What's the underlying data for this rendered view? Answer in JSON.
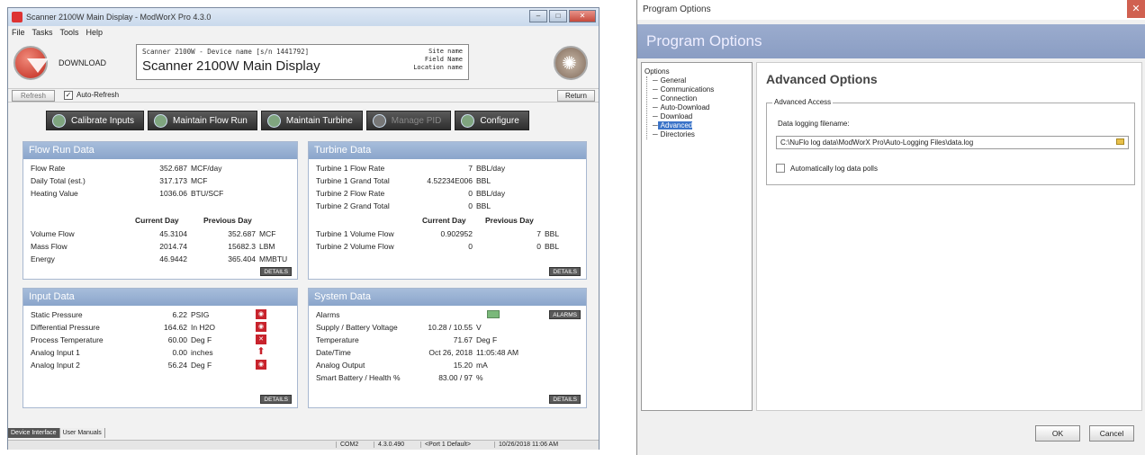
{
  "main_window": {
    "title": "Scanner 2100W Main Display - ModWorX Pro 4.3.0",
    "menu": [
      "File",
      "Tasks",
      "Tools",
      "Help"
    ],
    "download_label": "DOWNLOAD",
    "device_line": "Scanner 2100W - Device name [s/n 1441792]",
    "device_title": "Scanner 2100W Main Display",
    "site_name": "Site name",
    "field_name": "Field Name",
    "location_name": "Location name",
    "refresh_label": "Refresh",
    "auto_refresh_label": "Auto-Refresh",
    "return_label": "Return",
    "nav": {
      "calibrate": "Calibrate Inputs",
      "maintain_flow": "Maintain Flow Run",
      "maintain_turbine": "Maintain Turbine",
      "manage_pid": "Manage PID",
      "configure": "Configure"
    },
    "flow_run": {
      "title": "Flow Run Data",
      "rows": [
        {
          "label": "Flow Rate",
          "value": "352.687",
          "unit": "MCF/day"
        },
        {
          "label": "Daily Total (est.)",
          "value": "317.173",
          "unit": "MCF"
        },
        {
          "label": "Heating Value",
          "value": "1036.06",
          "unit": "BTU/SCF"
        }
      ],
      "current_day": "Current Day",
      "previous_day": "Previous Day",
      "history": [
        {
          "label": "Volume Flow",
          "current": "45.3104",
          "previous": "352.687",
          "unit": "MCF"
        },
        {
          "label": "Mass Flow",
          "current": "2014.74",
          "previous": "15682.3",
          "unit": "LBM"
        },
        {
          "label": "Energy",
          "current": "46.9442",
          "previous": "365.404",
          "unit": "MMBTU"
        }
      ],
      "details": "DETAILS"
    },
    "turbine": {
      "title": "Turbine Data",
      "rows": [
        {
          "label": "Turbine 1 Flow Rate",
          "value": "7",
          "unit": "BBL/day"
        },
        {
          "label": "Turbine 1 Grand Total",
          "value": "4.52234E006",
          "unit": "BBL"
        },
        {
          "label": "Turbine 2 Flow Rate",
          "value": "0",
          "unit": "BBL/day"
        },
        {
          "label": "Turbine 2 Grand Total",
          "value": "0",
          "unit": "BBL"
        }
      ],
      "current_day": "Current Day",
      "previous_day": "Previous Day",
      "history": [
        {
          "label": "Turbine 1 Volume Flow",
          "current": "0.902952",
          "previous": "7",
          "unit": "BBL"
        },
        {
          "label": "Turbine 2 Volume Flow",
          "current": "0",
          "previous": "0",
          "unit": "BBL"
        }
      ],
      "details": "DETAILS"
    },
    "input": {
      "title": "Input Data",
      "rows": [
        {
          "label": "Static Pressure",
          "value": "6.22",
          "unit": "PSIG"
        },
        {
          "label": "Differential Pressure",
          "value": "164.62",
          "unit": "In H2O"
        },
        {
          "label": "Process Temperature",
          "value": "60.00",
          "unit": "Deg F"
        },
        {
          "label": "Analog Input 1",
          "value": "0.00",
          "unit": "inches"
        },
        {
          "label": "Analog Input 2",
          "value": "56.24",
          "unit": "Deg F"
        }
      ],
      "details": "DETAILS"
    },
    "system": {
      "title": "System Data",
      "alarms_label": "Alarms",
      "alarms_button": "ALARMS",
      "rows": [
        {
          "label": "Supply / Battery Voltage",
          "value": "10.28 / 10.55",
          "unit": "V"
        },
        {
          "label": "Temperature",
          "value": "71.67",
          "unit": "Deg F"
        },
        {
          "label": "Date/Time",
          "value": "Oct 26, 2018",
          "unit": "11:05:48 AM"
        },
        {
          "label": "Analog Output",
          "value": "15.20",
          "unit": "mA"
        },
        {
          "label": "Smart Battery / Health %",
          "value": "83.00 / 97",
          "unit": "%"
        }
      ],
      "details": "DETAILS"
    },
    "tabs": [
      "Device Interface",
      "User Manuals"
    ],
    "status": {
      "port": "COM2",
      "version": "4.3.0.490",
      "port_default": "<Port 1 Default>",
      "datetime": "10/26/2018 11:06 AM"
    }
  },
  "dialog": {
    "title": "Program Options",
    "banner": "Program Options",
    "tree_root": "Options",
    "tree_items": [
      "General",
      "Communications",
      "Connection",
      "Auto-Download",
      "Download",
      "Advanced",
      "Directories"
    ],
    "heading": "Advanced Options",
    "group_title": "Advanced Access",
    "field_label": "Data logging filename:",
    "path_value": "C:\\NuFlo log data\\ModWorX Pro\\Auto-Logging Files\\data.log",
    "checkbox_label": "Automatically log data polls",
    "ok": "OK",
    "cancel": "Cancel"
  }
}
